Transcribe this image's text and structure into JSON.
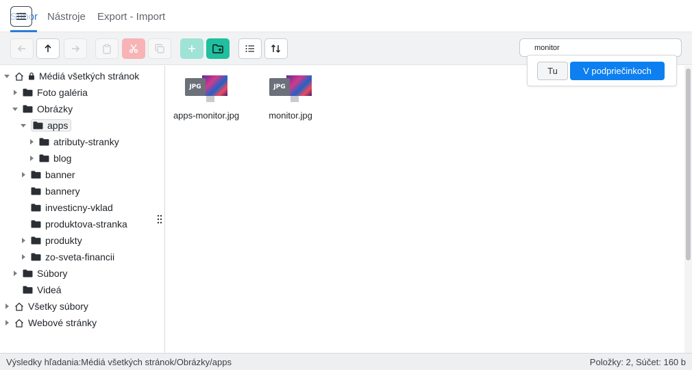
{
  "menu": {
    "tabs": [
      "Súbor",
      "Nástroje",
      "Export - Import"
    ]
  },
  "search": {
    "value": "monitor"
  },
  "search_popup": {
    "here_label": "Tu",
    "subfolders_label": "V podpriečinkoch"
  },
  "tree": [
    {
      "label": "Médiá všetkých stránok",
      "expanded": true,
      "icon": "home-icon",
      "locked": true
    },
    {
      "label": "Foto galéria",
      "expanded": false,
      "icon": "folder-icon"
    },
    {
      "label": "Obrázky",
      "expanded": true,
      "icon": "folder-icon"
    },
    {
      "label": "apps",
      "expanded": true,
      "icon": "folder-icon",
      "selected": true
    },
    {
      "label": "atributy-stranky",
      "expanded": false,
      "icon": "folder-icon"
    },
    {
      "label": "blog",
      "expanded": false,
      "icon": "folder-icon"
    },
    {
      "label": "banner",
      "expanded": false,
      "icon": "folder-icon"
    },
    {
      "label": "bannery",
      "icon": "folder-icon"
    },
    {
      "label": "investicny-vklad",
      "icon": "folder-icon"
    },
    {
      "label": "produktova-stranka",
      "icon": "folder-icon"
    },
    {
      "label": "produkty",
      "expanded": false,
      "icon": "folder-icon"
    },
    {
      "label": "zo-sveta-financii",
      "expanded": false,
      "icon": "folder-icon"
    },
    {
      "label": "Súbory",
      "expanded": false,
      "icon": "folder-icon"
    },
    {
      "label": "Videá",
      "icon": "folder-icon"
    },
    {
      "label": "Všetky súbory",
      "expanded": false,
      "icon": "home-icon"
    },
    {
      "label": "Webové stránky",
      "expanded": false,
      "icon": "home-icon"
    }
  ],
  "files": [
    {
      "name": "apps-monitor.jpg",
      "badge": "JPG"
    },
    {
      "name": "monitor.jpg",
      "badge": "JPG"
    }
  ],
  "status": {
    "left": "Výsledky hľadania:Médiá všetkých stránok/Obrázky/apps",
    "right": "Položky: 2, Súčet: 160 b"
  },
  "colors": {
    "accent": "#2a7bd6",
    "primary_button": "#0d7ff0",
    "teal": "#1fbf9f",
    "danger_disabled": "#f8b3b7"
  }
}
